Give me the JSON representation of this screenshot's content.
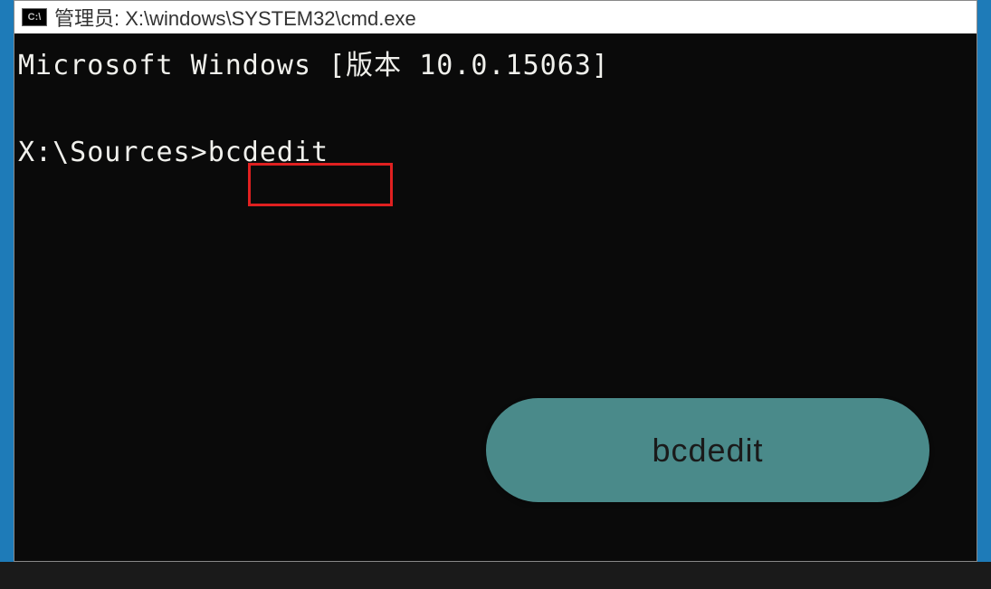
{
  "window": {
    "icon_text": "C:\\",
    "title": "管理员: X:\\windows\\SYSTEM32\\cmd.exe"
  },
  "terminal": {
    "version_line": "Microsoft Windows [版本 10.0.15063]",
    "prompt": "X:\\Sources>",
    "command": "bcdedit"
  },
  "callout": {
    "label": "bcdedit"
  },
  "colors": {
    "highlight_border": "#e02020",
    "bubble_bg": "#4a8a8a",
    "desktop_bg": "#1e7bb8"
  }
}
